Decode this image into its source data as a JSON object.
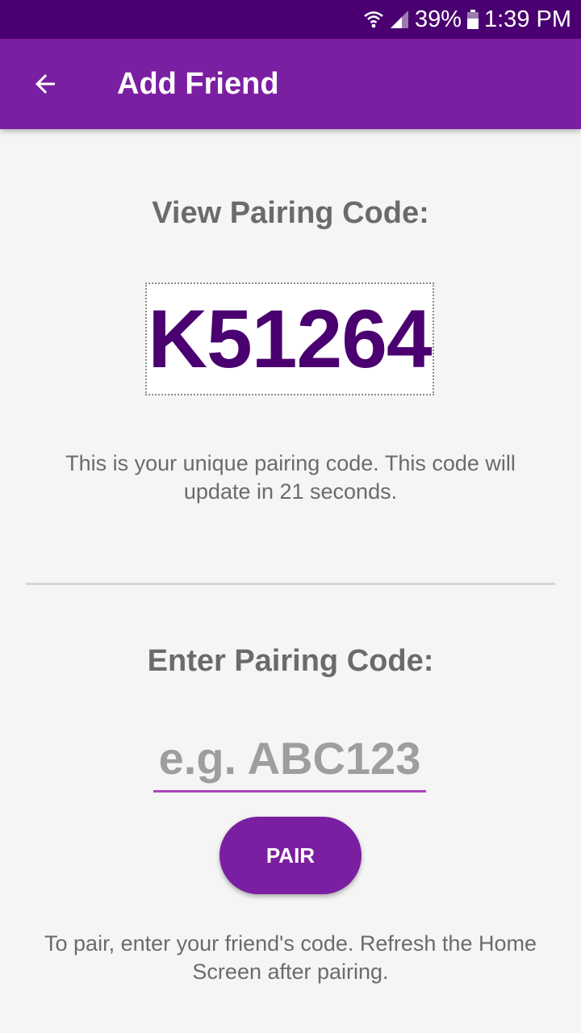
{
  "status_bar": {
    "battery_percent": "39%",
    "time": "1:39 PM",
    "icons": [
      "wifi-icon",
      "cell-signal-icon",
      "battery-icon"
    ]
  },
  "app_bar": {
    "title": "Add Friend",
    "back_icon": "arrow-back-icon"
  },
  "view_section": {
    "heading": "View Pairing Code:",
    "code": "K51264",
    "description": "This is your unique pairing code. This code will update in 21 seconds."
  },
  "enter_section": {
    "heading": "Enter Pairing Code:",
    "input_value": "",
    "input_placeholder": "e.g. ABC123",
    "pair_label": "PAIR",
    "instructions": "To pair, enter your friend's code. Refresh the Home Screen after pairing."
  },
  "colors": {
    "status_bar": "#4a0070",
    "primary": "#7b1fa2",
    "code_text": "#4a0070",
    "input_underline": "#ab47bc",
    "background": "#f5f5f5"
  }
}
